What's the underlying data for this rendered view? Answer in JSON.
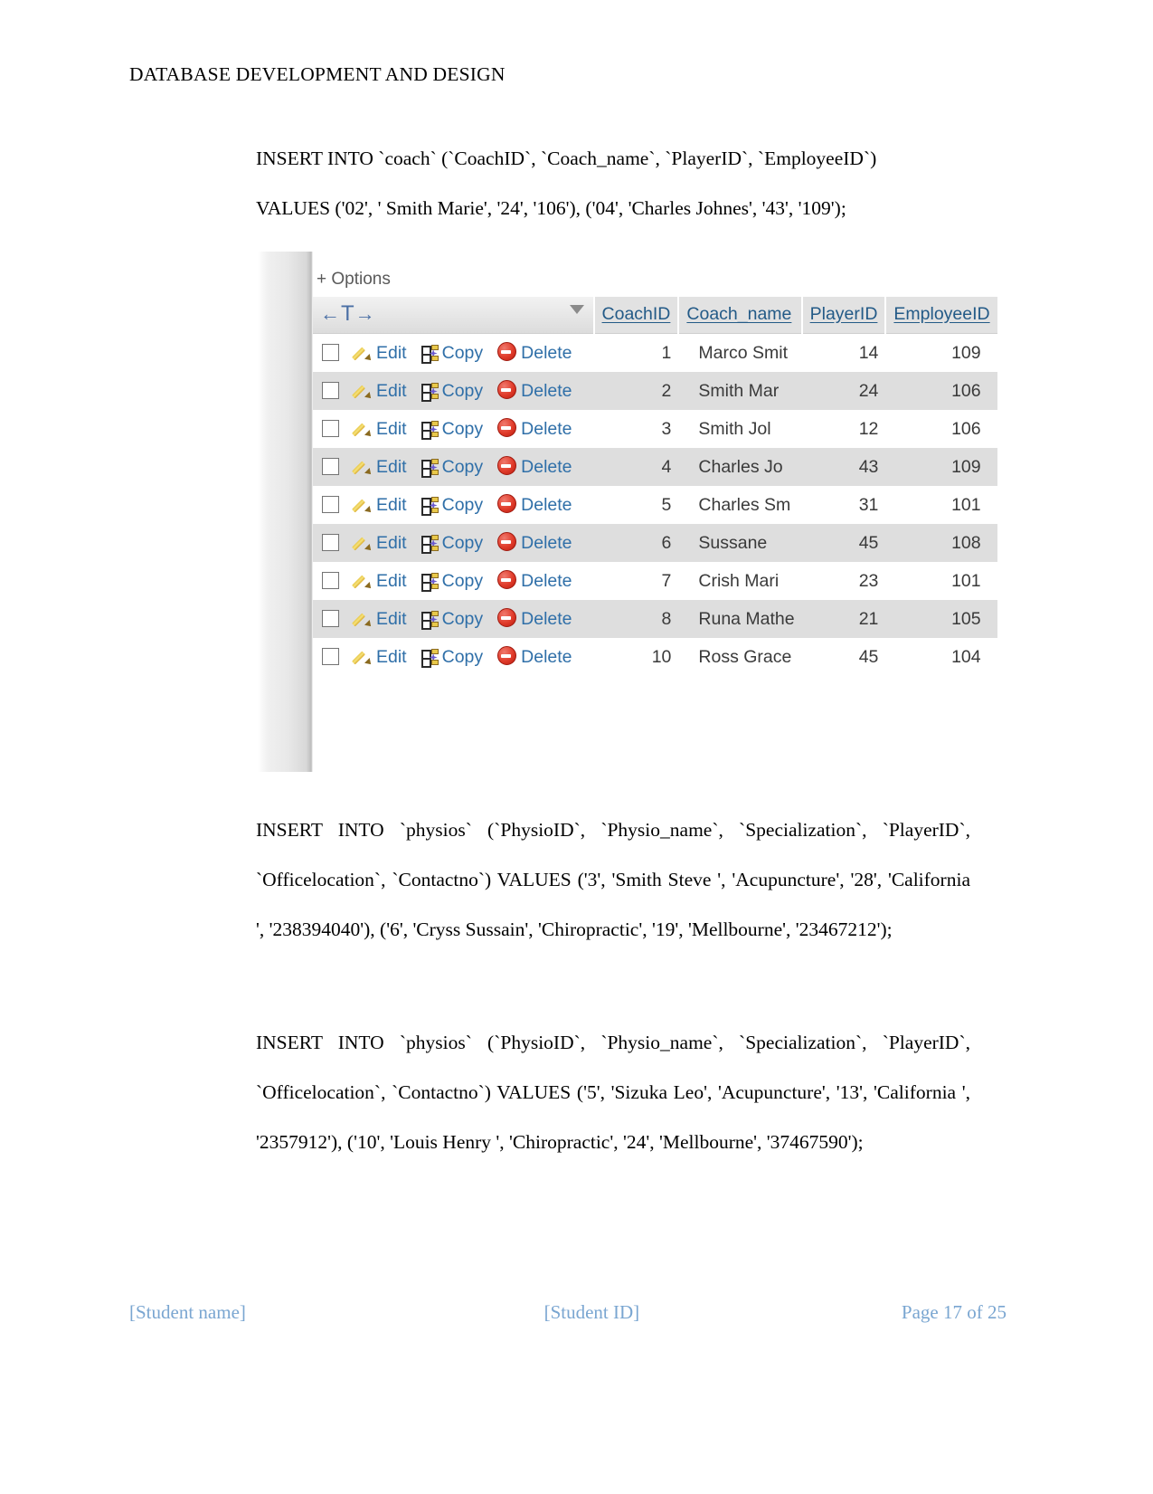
{
  "document": {
    "header_title": "DATABASE DEVELOPMENT AND DESIGN",
    "paragraphs": {
      "coach_insert": "INSERT INTO `coach` (`CoachID`, `Coach_name`, `PlayerID`, `EmployeeID`)",
      "coach_values": "VALUES ('02', ' Smith Marie', '24', '106'), ('04', 'Charles Johnes', '43', '109');",
      "physios_insert_1": "INSERT INTO `physios` (`PhysioID`, `Physio_name`, `Specialization`, `PlayerID`, `Officelocation`, `Contactno`) VALUES ('3', 'Smith Steve ', 'Acupuncture', '28', 'California ', '238394040'), ('6', 'Cryss Sussain', 'Chiropractic', '19', 'Mellbourne', '23467212');",
      "physios_insert_2": "INSERT INTO `physios` (`PhysioID`, `Physio_name`, `Specialization`, `PlayerID`, `Officelocation`, `Contactno`) VALUES ('5', 'Sizuka Leo', 'Acupuncture', '13', 'California ', '2357912'), ('10', 'Louis Henry ', 'Chiropractic', '24', 'Mellbourne', '37467590');"
    }
  },
  "footer": {
    "student_name": "[Student name]",
    "student_id": "[Student ID]",
    "page_label": "Page 17 of 25"
  },
  "phpmyadmin": {
    "options_label": "+ Options",
    "sort_nav": {
      "left_arrow": "←",
      "t_glyph": "T",
      "right_arrow": "→"
    },
    "actions": {
      "edit": "Edit",
      "copy": "Copy",
      "delete": "Delete"
    },
    "columns": [
      "CoachID",
      "Coach_name",
      "PlayerID",
      "EmployeeID"
    ],
    "rows": [
      {
        "CoachID": "1",
        "Coach_name": "Marco Smit",
        "PlayerID": "14",
        "EmployeeID": "109"
      },
      {
        "CoachID": "2",
        "Coach_name": "Smith Mar",
        "PlayerID": "24",
        "EmployeeID": "106"
      },
      {
        "CoachID": "3",
        "Coach_name": "Smith Jol",
        "PlayerID": "12",
        "EmployeeID": "106"
      },
      {
        "CoachID": "4",
        "Coach_name": "Charles Jo",
        "PlayerID": "43",
        "EmployeeID": "109"
      },
      {
        "CoachID": "5",
        "Coach_name": "Charles Sm",
        "PlayerID": "31",
        "EmployeeID": "101"
      },
      {
        "CoachID": "6",
        "Coach_name": "Sussane",
        "PlayerID": "45",
        "EmployeeID": "108"
      },
      {
        "CoachID": "7",
        "Coach_name": "Crish Mari",
        "PlayerID": "23",
        "EmployeeID": "101"
      },
      {
        "CoachID": "8",
        "Coach_name": "Runa Mathe",
        "PlayerID": "21",
        "EmployeeID": "105"
      },
      {
        "CoachID": "10",
        "Coach_name": "Ross Grace",
        "PlayerID": "45",
        "EmployeeID": "104"
      }
    ]
  },
  "colors": {
    "link_blue": "#2f6fa8",
    "header_blue": "#235a87",
    "footer_blue": "#7aa6d1",
    "row_even_bg": "#dedede",
    "header_bg": "#e2e2e2",
    "delete_red": "#e03b2a"
  }
}
